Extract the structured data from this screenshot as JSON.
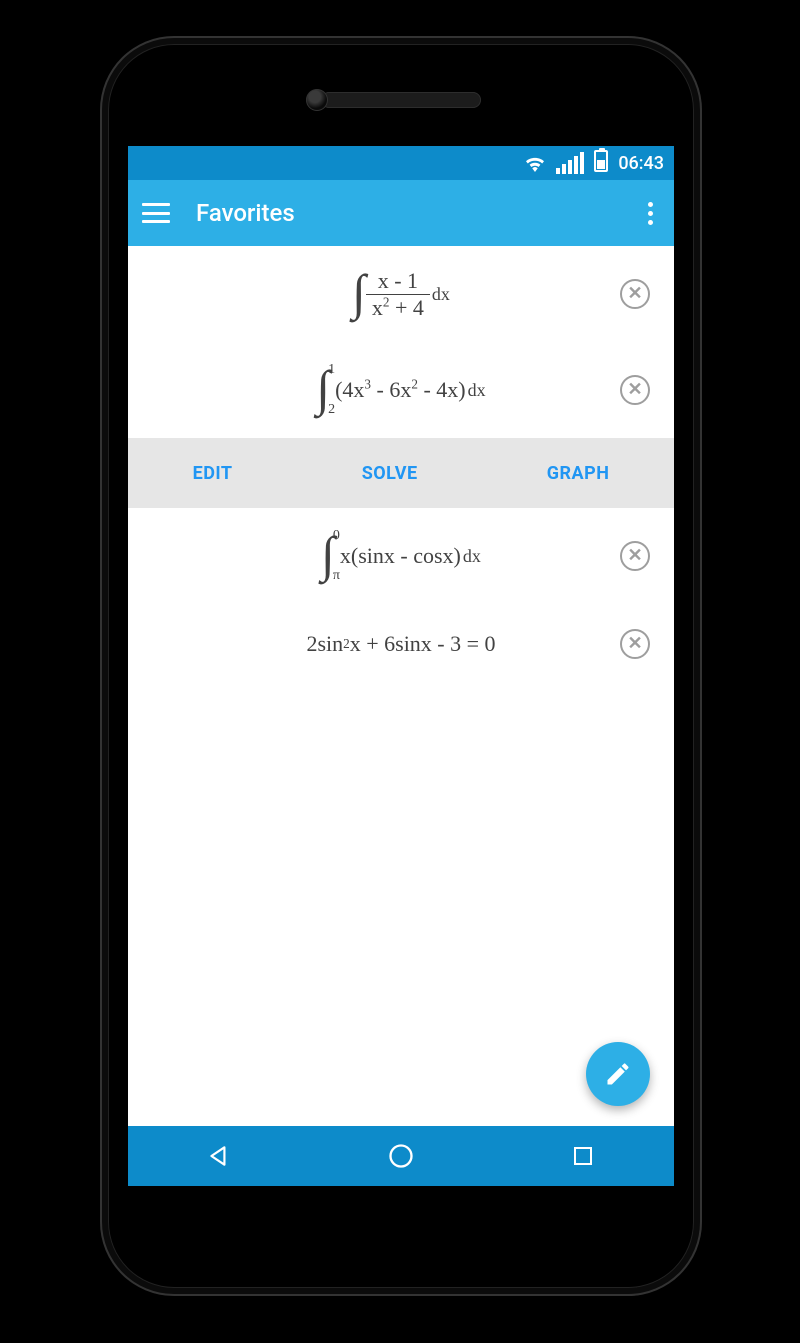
{
  "status": {
    "time": "06:43",
    "battery_pct": 45
  },
  "header": {
    "title": "Favorites"
  },
  "actions": {
    "edit": "EDIT",
    "solve": "SOLVE",
    "graph": "GRAPH"
  },
  "icons": {
    "menu": "menu-icon",
    "more": "more-vert-icon",
    "wifi": "wifi-icon",
    "signal": "signal-icon",
    "battery": "battery-icon",
    "fab": "pencil-icon",
    "delete": "close-circle-icon",
    "nav_back": "triangle-back-icon",
    "nav_home": "circle-home-icon",
    "nav_recent": "square-recent-icon"
  },
  "favorites": [
    {
      "id": "f1",
      "kind": "integral_indef",
      "integrand_tex": "(x - 1)/(x^2 + 4)",
      "numerator": "x - 1",
      "denominator_base": "x",
      "denominator_exp": "2",
      "denominator_tail": " + 4",
      "differential": "dx"
    },
    {
      "id": "f2",
      "kind": "integral_def",
      "lower": "2",
      "upper": "1",
      "body_parts": {
        "open": "(4x",
        "e1": "3",
        "mid1": " - 6x",
        "e2": "2",
        "mid2": " - 4x)",
        "dx": "dx"
      },
      "selected": true
    },
    {
      "id": "f3",
      "kind": "integral_def",
      "lower": "π",
      "upper": "0",
      "body": "x(sinx - cosx)",
      "differential": "dx"
    },
    {
      "id": "f4",
      "kind": "equation",
      "parts": {
        "a": "2sin",
        "e1": "2",
        "b": "x + 6sinx - 3 = 0"
      }
    }
  ]
}
